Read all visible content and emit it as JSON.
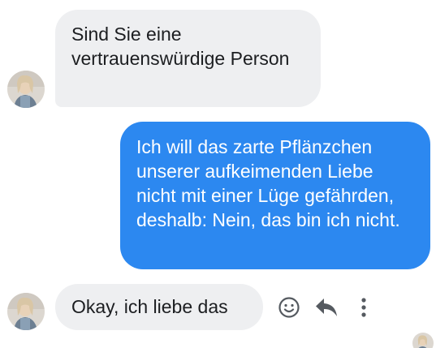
{
  "messages": [
    {
      "direction": "incoming",
      "text": "Sind Sie eine vertrauenswürdige Person"
    },
    {
      "direction": "outgoing",
      "text": "Ich will das zarte Pflänzchen unserer aufkeimenden Liebe nicht mit einer Lüge gefährden, deshalb: Nein, das bin ich nicht."
    },
    {
      "direction": "incoming",
      "text": "Okay, ich liebe das"
    }
  ],
  "actions": [
    {
      "icon": "smiley-icon"
    },
    {
      "icon": "reply-icon"
    },
    {
      "icon": "more-vertical-icon"
    }
  ],
  "colors": {
    "incoming_bubble": "#eeeff1",
    "outgoing_bubble": "#2c88f0",
    "icon": "#555a60"
  }
}
